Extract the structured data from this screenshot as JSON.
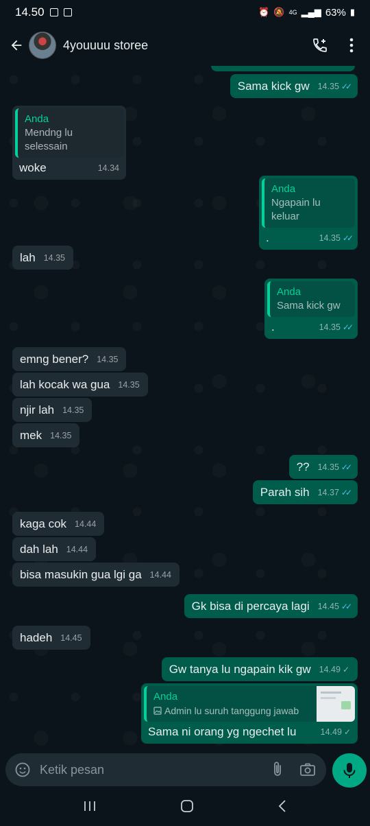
{
  "status": {
    "time": "14.50",
    "network": "4G",
    "battery": "63%"
  },
  "header": {
    "contact_name": "4youuuu storee"
  },
  "messages": [
    {
      "text": "Sama kick gw",
      "time": "14.35"
    },
    {
      "quote_name": "Anda",
      "quote_text": "Mendng lu selessain",
      "text": "woke",
      "time": "14.34"
    },
    {
      "quote_name": "Anda",
      "quote_text": "Ngapain lu keluar",
      "text": ".",
      "time": "14.35"
    },
    {
      "text": "lah",
      "time": "14.35"
    },
    {
      "quote_name": "Anda",
      "quote_text": "Sama kick gw",
      "text": ".",
      "time": "14.35"
    },
    {
      "text": "emng bener?",
      "time": "14.35"
    },
    {
      "text": "lah kocak wa gua",
      "time": "14.35"
    },
    {
      "text": "njir lah",
      "time": "14.35"
    },
    {
      "text": "mek",
      "time": "14.35"
    },
    {
      "text": "??",
      "time": "14.35"
    },
    {
      "text": "Parah sih",
      "time": "14.37"
    },
    {
      "text": "kaga cok",
      "time": "14.44"
    },
    {
      "text": "dah lah",
      "time": "14.44"
    },
    {
      "text": "bisa masukin gua lgi ga",
      "time": "14.44"
    },
    {
      "text": "Gk bisa di percaya lagi",
      "time": "14.45"
    },
    {
      "text": "hadeh",
      "time": "14.45"
    },
    {
      "text": "Gw tanya lu ngapain kik gw",
      "time": "14.49"
    },
    {
      "quote_name": "Anda",
      "quote_text": "Admin lu suruh tanggung jawab",
      "text": "Sama ni orang yg ngechet lu",
      "time": "14.49"
    }
  ],
  "composer": {
    "placeholder": "Ketik pesan"
  },
  "icons": [
    "back-arrow-icon",
    "add-call-icon",
    "more-vert-icon",
    "emoji-icon",
    "attach-icon",
    "camera-icon",
    "mic-icon",
    "recents-icon",
    "home-icon",
    "nav-back-icon",
    "image-icon"
  ],
  "colors": {
    "background": "#0b141a",
    "incoming": "#202c33",
    "outgoing": "#005c4b",
    "accent": "#00a884",
    "read_ticks": "#53bdeb"
  }
}
